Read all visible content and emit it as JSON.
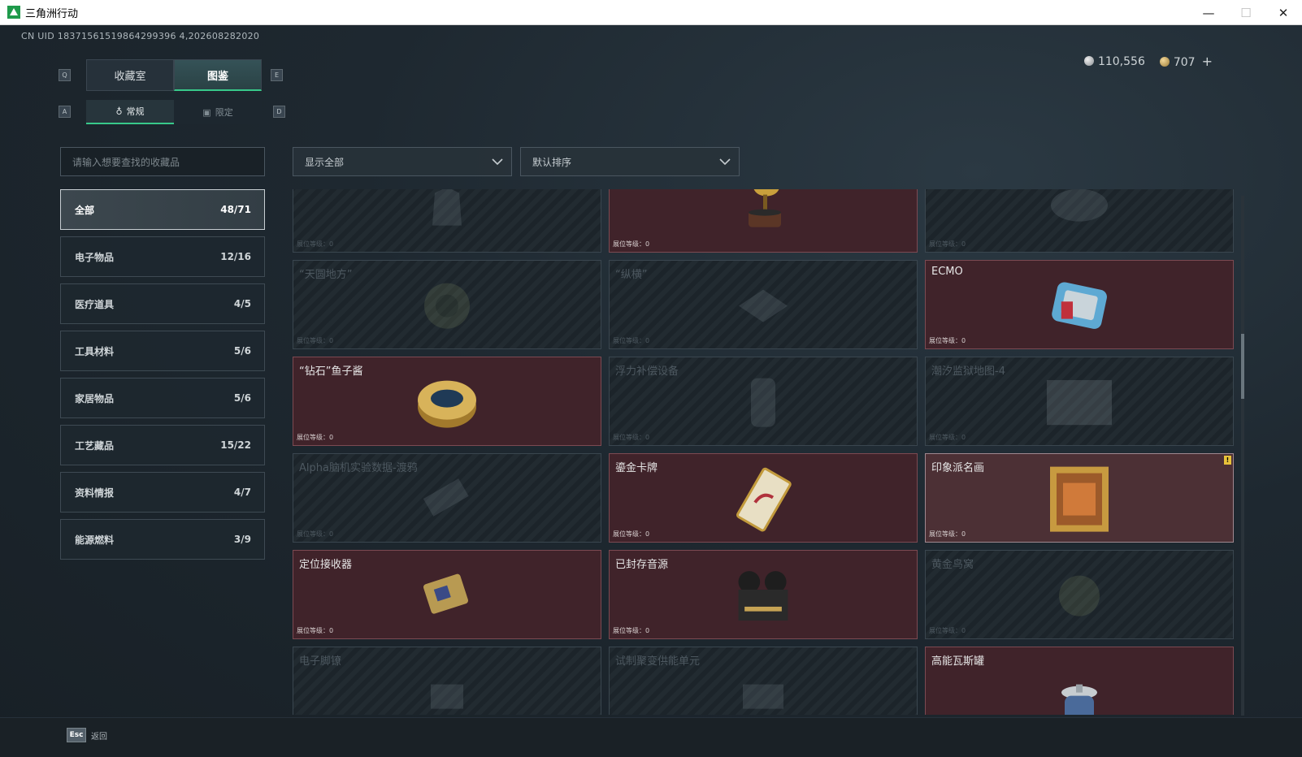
{
  "window": {
    "title": "三角洲行动",
    "minimize": "—",
    "maximize": "☐",
    "close": "✕"
  },
  "header": {
    "uid": "CN UID 18371561519864299396 4,202608282020",
    "currency_silver": "110,556",
    "currency_gold": "707",
    "plus": "+"
  },
  "keys": {
    "q": "Q",
    "e": "E",
    "a": "A",
    "d": "D"
  },
  "tabs": [
    {
      "label": "收藏室"
    },
    {
      "label": "图鉴"
    }
  ],
  "subtabs": [
    {
      "label": "常规"
    },
    {
      "label": "限定"
    }
  ],
  "search": {
    "placeholder": "请输入想要查找的收藏品"
  },
  "filters": {
    "show": "显示全部",
    "sort": "默认排序"
  },
  "categories": [
    {
      "label": "全部",
      "count": "48/71"
    },
    {
      "label": "电子物品",
      "count": "12/16"
    },
    {
      "label": "医疗道具",
      "count": "4/5"
    },
    {
      "label": "工具材料",
      "count": "5/6"
    },
    {
      "label": "家居物品",
      "count": "5/6"
    },
    {
      "label": "工艺藏品",
      "count": "15/22"
    },
    {
      "label": "资料情报",
      "count": "4/7"
    },
    {
      "label": "能源燃料",
      "count": "3/9"
    }
  ],
  "level_label": "展位等级：0",
  "items": [
    {
      "name": "",
      "owned": false,
      "icon": "vest-icon"
    },
    {
      "name": "",
      "owned": true,
      "icon": "gramophone-icon"
    },
    {
      "name": "",
      "owned": false,
      "icon": "bowl-icon"
    },
    {
      "name": "“天圆地方”",
      "owned": false,
      "icon": "compass-icon"
    },
    {
      "name": "“纵横”",
      "owned": false,
      "icon": "chessboard-icon"
    },
    {
      "name": "ECMO",
      "owned": true,
      "icon": "ecmo-icon"
    },
    {
      "name": "“钻石”鱼子酱",
      "owned": true,
      "icon": "caviar-tin-icon"
    },
    {
      "name": "浮力补偿设备",
      "owned": false,
      "icon": "bcd-icon"
    },
    {
      "name": "潮汐监狱地图-4",
      "owned": false,
      "icon": "map-icon"
    },
    {
      "name": "Alpha脑机实验数据-渡鸦",
      "owned": false,
      "icon": "data-drive-icon"
    },
    {
      "name": "鎏金卡牌",
      "owned": true,
      "icon": "gilded-card-icon"
    },
    {
      "name": "印象派名画",
      "owned": true,
      "icon": "painting-icon",
      "selected": true
    },
    {
      "name": "定位接收器",
      "owned": true,
      "icon": "receiver-icon"
    },
    {
      "name": "已封存音源",
      "owned": true,
      "icon": "reel-recorder-icon"
    },
    {
      "name": "黄金鸟窝",
      "owned": false,
      "icon": "bird-nest-icon"
    },
    {
      "name": "电子脚镣",
      "owned": false,
      "icon": "ankle-monitor-icon"
    },
    {
      "name": "试制聚变供能单元",
      "owned": false,
      "icon": "fusion-unit-icon"
    },
    {
      "name": "高能瓦斯罐",
      "owned": true,
      "icon": "gas-canister-icon"
    }
  ],
  "footer": {
    "esc_key": "Esc",
    "back": "返回"
  },
  "colors": {
    "accent": "#38c98a",
    "owned_bg": "#40232a",
    "warning": "#e8c23a"
  }
}
